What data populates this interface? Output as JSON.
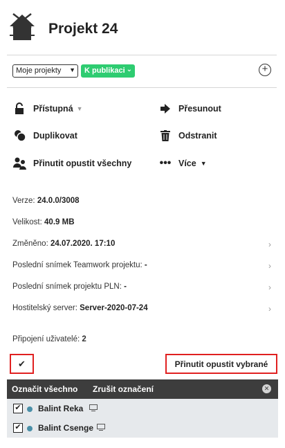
{
  "header": {
    "title": "Projekt 24"
  },
  "filters": {
    "project_select": "Moje projekty",
    "publish_button": "K publikaci",
    "add_button": "+"
  },
  "actions": {
    "access": "Přístupná",
    "move": "Přesunout",
    "duplicate": "Duplikovat",
    "delete": "Odstranit",
    "force_leave_all": "Přinutit opustit všechny",
    "more": "Více"
  },
  "info": {
    "version_label": "Verze:",
    "version_value": "24.0.0/3008",
    "size_label": "Velikost:",
    "size_value": "40.9 MB",
    "modified_label": "Změněno:",
    "modified_value": "24.07.2020. 17:10",
    "teamwork_label": "Poslední snímek Teamwork projektu:",
    "teamwork_value": "-",
    "pln_label": "Poslední snímek projektu PLN:",
    "pln_value": "-",
    "host_label": "Hostitelský server:",
    "host_value": "Server-2020-07-24"
  },
  "users": {
    "connected_label": "Připojení uživatelé:",
    "connected_count": "2",
    "check_all_glyph": "✔",
    "force_selected": "Přinutit opustit vybrané",
    "select_all": "Označit všechno",
    "deselect": "Zrušit označení",
    "close_glyph": "✕",
    "list": [
      {
        "name": "Balint Reka",
        "checked": "✔"
      },
      {
        "name": "Balint Csenge",
        "checked": "✔"
      }
    ]
  },
  "colors": {
    "accent_green": "#2ecc71",
    "highlight_red": "#e02020",
    "toolbar_dark": "#3d3d3d",
    "status_dot": "#4a8fa8"
  }
}
